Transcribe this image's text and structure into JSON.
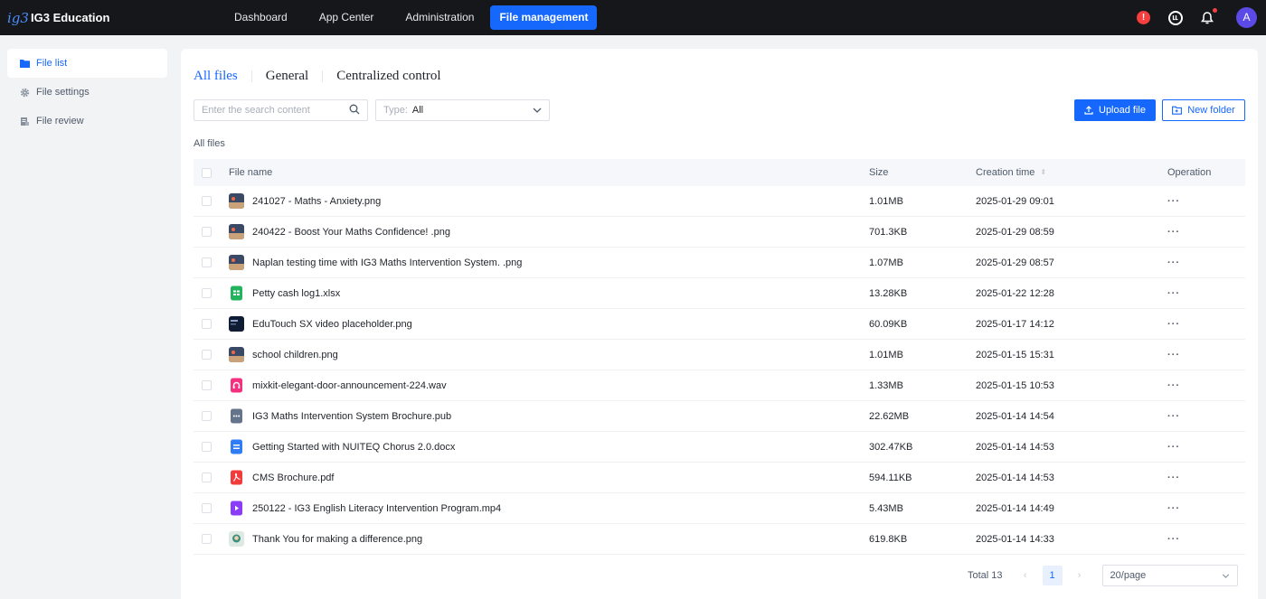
{
  "brand": {
    "logo": "ig3",
    "name": "IG3 Education"
  },
  "nav": {
    "items": [
      {
        "label": "Dashboard"
      },
      {
        "label": "App Center"
      },
      {
        "label": "Administration"
      },
      {
        "label": "File management"
      }
    ],
    "active_index": 3
  },
  "header": {
    "alert_icon": "!",
    "avatar_initial": "A"
  },
  "sidebar": {
    "items": [
      {
        "label": "File list",
        "icon": "folder-icon"
      },
      {
        "label": "File settings",
        "icon": "gear-icon"
      },
      {
        "label": "File review",
        "icon": "document-icon"
      }
    ]
  },
  "tabs": [
    {
      "label": "All files"
    },
    {
      "label": "General"
    },
    {
      "label": "Centralized control"
    }
  ],
  "search": {
    "placeholder": "Enter the search content",
    "value": ""
  },
  "filter": {
    "label": "Type:",
    "value": "All"
  },
  "actions": {
    "upload_label": "Upload file",
    "new_folder_label": "New folder"
  },
  "breadcrumb": "All files",
  "table": {
    "columns": {
      "name": "File name",
      "size": "Size",
      "time": "Creation time",
      "operation": "Operation"
    },
    "rows": [
      {
        "name": "241027 - Maths - Anxiety.png",
        "size": "1.01MB",
        "time": "2025-01-29 09:01",
        "type": "image"
      },
      {
        "name": "240422 - Boost Your Maths Confidence! .png",
        "size": "701.3KB",
        "time": "2025-01-29 08:59",
        "type": "image"
      },
      {
        "name": "Naplan testing time with IG3 Maths Intervention System. .png",
        "size": "1.07MB",
        "time": "2025-01-29 08:57",
        "type": "image"
      },
      {
        "name": "Petty cash log1.xlsx",
        "size": "13.28KB",
        "time": "2025-01-22 12:28",
        "type": "xlsx"
      },
      {
        "name": "EduTouch SX video placeholder.png",
        "size": "60.09KB",
        "time": "2025-01-17 14:12",
        "type": "image-dark"
      },
      {
        "name": "school children.png",
        "size": "1.01MB",
        "time": "2025-01-15 15:31",
        "type": "image"
      },
      {
        "name": "mixkit-elegant-door-announcement-224.wav",
        "size": "1.33MB",
        "time": "2025-01-15 10:53",
        "type": "audio"
      },
      {
        "name": "IG3 Maths Intervention System Brochure.pub",
        "size": "22.62MB",
        "time": "2025-01-14 14:54",
        "type": "pub"
      },
      {
        "name": "Getting Started with NUITEQ Chorus 2.0.docx",
        "size": "302.47KB",
        "time": "2025-01-14 14:53",
        "type": "docx"
      },
      {
        "name": "CMS Brochure.pdf",
        "size": "594.11KB",
        "time": "2025-01-14 14:53",
        "type": "pdf"
      },
      {
        "name": "250122 - IG3 English Literacy Intervention Program.mp4",
        "size": "5.43MB",
        "time": "2025-01-14 14:49",
        "type": "video"
      },
      {
        "name": "Thank You for making a difference.png",
        "size": "619.8KB",
        "time": "2025-01-14 14:33",
        "type": "image-light"
      }
    ]
  },
  "pagination": {
    "total_label": "Total 13",
    "current_page": "1",
    "page_size": "20/page"
  },
  "colors": {
    "primary": "#1668fc",
    "topbar": "#15171b",
    "alert": "#f53f3f",
    "avatar": "#5b4ae6"
  }
}
